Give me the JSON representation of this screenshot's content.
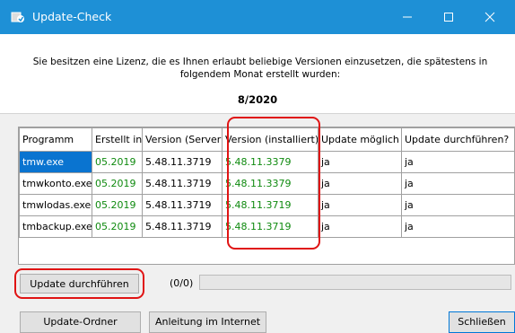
{
  "window": {
    "title": "Update-Check",
    "minimize_icon": "minimize-icon",
    "maximize_icon": "maximize-icon",
    "close_icon": "close-icon",
    "titlebar_color": "#1e90d6"
  },
  "header": {
    "message": "Sie besitzen eine Lizenz, die es Ihnen erlaubt beliebige Versionen einzusetzen, die spätestens in folgendem Monat erstellt wurden:",
    "date": "8/2020"
  },
  "table": {
    "columns": [
      "Programm",
      "Erstellt in",
      "Version (Server)",
      "Version (installiert)",
      "Update möglich",
      "Update durchführen?"
    ],
    "rows": [
      {
        "programm": "tmw.exe",
        "erstellt": "05.2019",
        "server": "5.48.11.3719",
        "installiert": "5.48.11.3379",
        "moeglich": "ja",
        "durchfuehren": "ja"
      },
      {
        "programm": "tmwkonto.exe",
        "erstellt": "05.2019",
        "server": "5.48.11.3719",
        "installiert": "5.48.11.3379",
        "moeglich": "ja",
        "durchfuehren": "ja"
      },
      {
        "programm": "tmwlodas.exe",
        "erstellt": "05.2019",
        "server": "5.48.11.3719",
        "installiert": "5.48.11.3719",
        "moeglich": "ja",
        "durchfuehren": "ja"
      },
      {
        "programm": "tmbackup.exe",
        "erstellt": "05.2019",
        "server": "5.48.11.3719",
        "installiert": "5.48.11.3719",
        "moeglich": "ja",
        "durchfuehren": "ja"
      }
    ],
    "selected_row": 0,
    "green_color": "#0f8a0f"
  },
  "actions": {
    "update_button": "Update durchführen",
    "progress_text": "(0/0)",
    "progress_fraction": 0
  },
  "footer": {
    "update_folder": "Update-Ordner",
    "internet_guide": "Anleitung im Internet",
    "close": "Schließen"
  },
  "annotations": {
    "color": "#e01414"
  }
}
